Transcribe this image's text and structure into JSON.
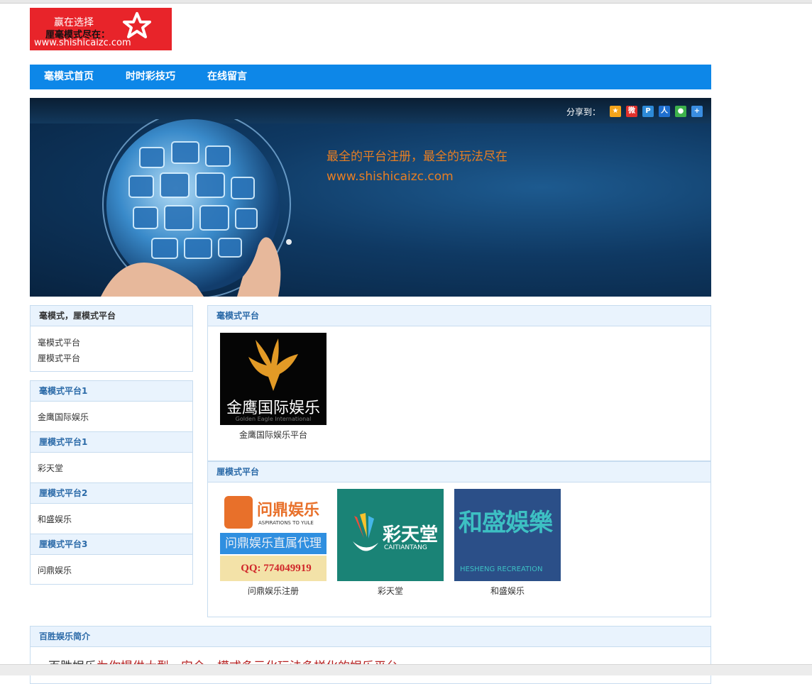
{
  "logo": {
    "line1": "赢在选择",
    "line2": "厘毫模式尽在：",
    "line3": "www.shishicaizc.com"
  },
  "nav": {
    "items": [
      "毫模式首页",
      "时时彩技巧",
      "在线留言"
    ]
  },
  "banner": {
    "share_label": "分享到：",
    "share_icons": [
      "qzone-icon",
      "weibo-icon",
      "pengyou-icon",
      "renren-icon",
      "wechat-icon",
      "more-share-icon"
    ],
    "slogan": "最全的平台注册，最全的玩法尽在",
    "url": "www.shishicaizc.com"
  },
  "sidebar": {
    "box1": {
      "title": "毫模式，厘模式平台",
      "links": [
        "毫模式平台",
        "厘模式平台"
      ]
    },
    "sections": [
      {
        "title": "毫模式平台1",
        "item": "金鹰国际娱乐"
      },
      {
        "title": "厘模式平台1",
        "item": "彩天堂"
      },
      {
        "title": "厘模式平台2",
        "item": "和盛娱乐"
      },
      {
        "title": "厘模式平台3",
        "item": "问鼎娱乐"
      }
    ]
  },
  "main": {
    "hao": {
      "title": "毫模式平台",
      "cards": [
        {
          "caption": "金鹰国际娱乐平台",
          "img_text": "金鹰国际娱乐",
          "img_sub": "Golden Eagle International"
        }
      ]
    },
    "li": {
      "title": "厘模式平台",
      "cards": [
        {
          "caption": "问鼎娱乐注册",
          "brand": "问鼎娱乐",
          "tagline": "ASPIRATIONS TO YULE",
          "agent": "问鼎娱乐直属代理",
          "qq": "QQ: 774049919"
        },
        {
          "caption": "彩天堂",
          "brand": "彩天堂",
          "sub": "CAITIANTANG"
        },
        {
          "caption": "和盛娱乐",
          "brand": "和盛娛樂",
          "sub": "HESHENG RECREATION"
        }
      ]
    }
  },
  "intro": {
    "title": "百胜娱乐简介",
    "lead": "百胜娱乐",
    "text": "为你提供大型，安全，模式多元化玩法多样化的娱乐平台"
  },
  "colors": {
    "nav_bg": "#0d87e8",
    "panel_head_bg": "#e9f3fd",
    "panel_border": "#c7dcef",
    "logo_bg": "#e8242a",
    "slogan": "#e87e22"
  }
}
